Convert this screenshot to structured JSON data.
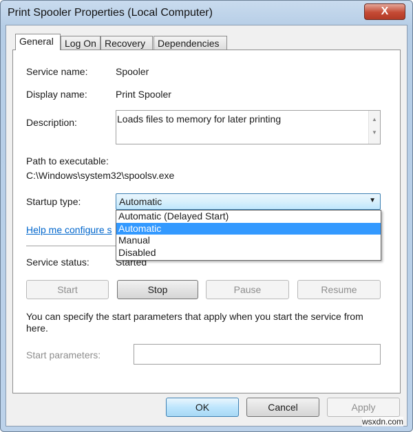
{
  "window": {
    "title": "Print Spooler Properties (Local Computer)",
    "close_label": "X"
  },
  "tabs": [
    {
      "label": "General",
      "active": true
    },
    {
      "label": "Log On"
    },
    {
      "label": "Recovery"
    },
    {
      "label": "Dependencies"
    }
  ],
  "general": {
    "service_name_label": "Service name:",
    "service_name": "Spooler",
    "display_name_label": "Display name:",
    "display_name": "Print Spooler",
    "description_label": "Description:",
    "description": "Loads files to memory for later printing",
    "path_label": "Path to executable:",
    "path": "C:\\Windows\\system32\\spoolsv.exe",
    "startup_label": "Startup type:",
    "startup_value": "Automatic",
    "startup_options": [
      "Automatic (Delayed Start)",
      "Automatic",
      "Manual",
      "Disabled"
    ],
    "startup_selected": "Automatic",
    "help_link": "Help me configure s",
    "status_label": "Service status:",
    "status_value": "Started",
    "buttons": {
      "start": "Start",
      "stop": "Stop",
      "pause": "Pause",
      "resume": "Resume"
    },
    "params_note": "You can specify the start parameters that apply when you start the service from here.",
    "params_label": "Start parameters:",
    "params_value": ""
  },
  "footer": {
    "ok": "OK",
    "cancel": "Cancel",
    "apply": "Apply"
  },
  "watermark": "wsxdn.com",
  "colors": {
    "highlight": "#3399ff",
    "link": "#0066cc"
  }
}
